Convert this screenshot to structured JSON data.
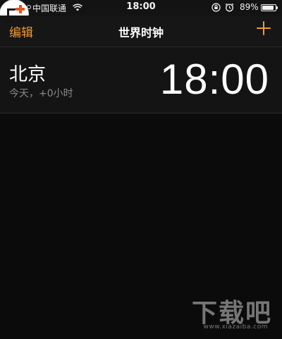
{
  "status_bar": {
    "carrier": "中国联通",
    "time": "18:00",
    "battery_percent": "89%",
    "battery_level": 0.89,
    "signal_bars_filled": 4,
    "signal_bars_total": 5,
    "icons": [
      "signal-dots-icon",
      "wifi-icon",
      "rotation-lock-icon",
      "alarm-icon",
      "battery-icon"
    ]
  },
  "nav": {
    "edit_label": "编辑",
    "title": "世界时钟",
    "add_icon": "plus-icon"
  },
  "clocks": [
    {
      "city": "北京",
      "offset": "今天，+0小时",
      "time": "18:00"
    }
  ],
  "watermark": {
    "brand": "下载吧",
    "url": "www.xiazaiba.com"
  },
  "colors": {
    "accent": "#f29a36",
    "background": "#0b0b0b",
    "row_background": "#141414",
    "secondary_text": "#8a8a8a"
  }
}
